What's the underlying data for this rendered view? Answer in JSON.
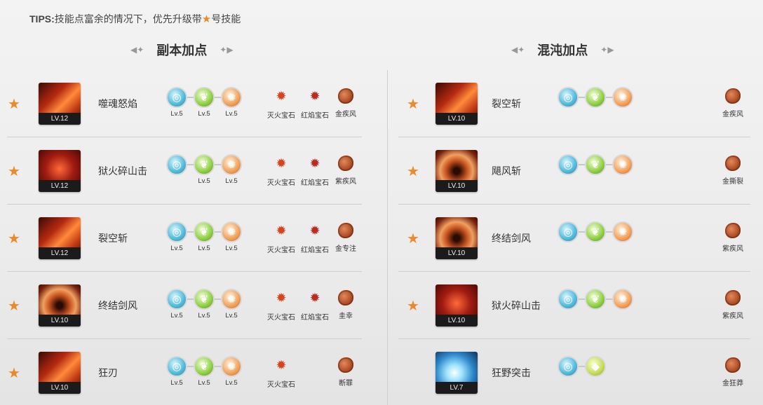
{
  "tips": {
    "prefix": "TIPS:",
    "text_before_star": "技能点富余的情况下，优先升级带",
    "text_after_star": "号技能"
  },
  "sections": {
    "left_title": "副本加点",
    "right_title": "混沌加点"
  },
  "colors": {
    "star": "#ea8a2b",
    "lv_bar": "#1b1b1b",
    "divider": "#cfcfcf"
  },
  "left_rows": [
    {
      "name": "噬魂怒焰",
      "level": "LV.12",
      "starred": true,
      "art": "fire-slash",
      "runes": [
        {
          "icon": "blue",
          "lv": "Lv.5"
        },
        {
          "icon": "green",
          "lv": "Lv.5"
        },
        {
          "icon": "orange",
          "lv": "Lv.5"
        }
      ],
      "gems": [
        {
          "type": "fire",
          "label": "灭火宝石"
        },
        {
          "type": "red",
          "label": "红焰宝石"
        }
      ],
      "emblem": "金疾风"
    },
    {
      "name": "狱火碎山击",
      "level": "LV.12",
      "starred": true,
      "art": "sword-red",
      "runes": [
        {
          "icon": "blue",
          "lv": ""
        },
        {
          "icon": "green",
          "lv": "Lv.5"
        },
        {
          "icon": "orange",
          "lv": "Lv.5"
        }
      ],
      "gems": [
        {
          "type": "fire",
          "label": "灭火宝石"
        },
        {
          "type": "red",
          "label": "红焰宝石"
        }
      ],
      "emblem": "紫疾风"
    },
    {
      "name": "裂空斩",
      "level": "LV.12",
      "starred": true,
      "art": "fire-slash",
      "runes": [
        {
          "icon": "blue",
          "lv": "Lv.5"
        },
        {
          "icon": "green",
          "lv": "Lv.5"
        },
        {
          "icon": "orange",
          "lv": "Lv.5"
        }
      ],
      "gems": [
        {
          "type": "fire",
          "label": "灭火宝石"
        },
        {
          "type": "red",
          "label": "红焰宝石"
        }
      ],
      "emblem": "金专注"
    },
    {
      "name": "终结剑风",
      "level": "LV.10",
      "starred": true,
      "art": "vortex",
      "runes": [
        {
          "icon": "blue",
          "lv": "Lv.5"
        },
        {
          "icon": "green",
          "lv": "Lv.5"
        },
        {
          "icon": "orange",
          "lv": "Lv.5"
        }
      ],
      "gems": [
        {
          "type": "fire",
          "label": "灭火宝石"
        },
        {
          "type": "red",
          "label": "红焰宝石"
        }
      ],
      "emblem": "圭幸"
    },
    {
      "name": "狂刃",
      "level": "LV.10",
      "starred": true,
      "art": "fire-slash",
      "runes": [
        {
          "icon": "blue",
          "lv": "Lv.5"
        },
        {
          "icon": "green",
          "lv": "Lv.5"
        },
        {
          "icon": "orange",
          "lv": "Lv.5"
        }
      ],
      "gems": [
        {
          "type": "fire",
          "label": "灭火宝石"
        }
      ],
      "emblem": "断罪"
    }
  ],
  "right_rows": [
    {
      "name": "裂空斩",
      "level": "LV.10",
      "starred": true,
      "art": "fire-slash",
      "runes": [
        {
          "icon": "blue"
        },
        {
          "icon": "green"
        },
        {
          "icon": "orange"
        }
      ],
      "emblem": "金疾风"
    },
    {
      "name": "飓风斩",
      "level": "LV.10",
      "starred": true,
      "art": "vortex",
      "runes": [
        {
          "icon": "blue"
        },
        {
          "icon": "green"
        },
        {
          "icon": "orange"
        }
      ],
      "emblem": "金撕裂"
    },
    {
      "name": "终结剑风",
      "level": "LV.10",
      "starred": true,
      "art": "vortex",
      "runes": [
        {
          "icon": "blue"
        },
        {
          "icon": "green"
        },
        {
          "icon": "orange"
        }
      ],
      "emblem": "紫疾风"
    },
    {
      "name": "狱火碎山击",
      "level": "LV.10",
      "starred": true,
      "art": "sword-red",
      "runes": [
        {
          "icon": "blue"
        },
        {
          "icon": "green"
        },
        {
          "icon": "orange"
        }
      ],
      "emblem": "紫疾风"
    },
    {
      "name": "狂野突击",
      "level": "LV.7",
      "starred": false,
      "art": "blue-burst",
      "runes": [
        {
          "icon": "blue"
        },
        {
          "icon": "yellowgreen"
        }
      ],
      "emblem": "金狂莽"
    }
  ]
}
